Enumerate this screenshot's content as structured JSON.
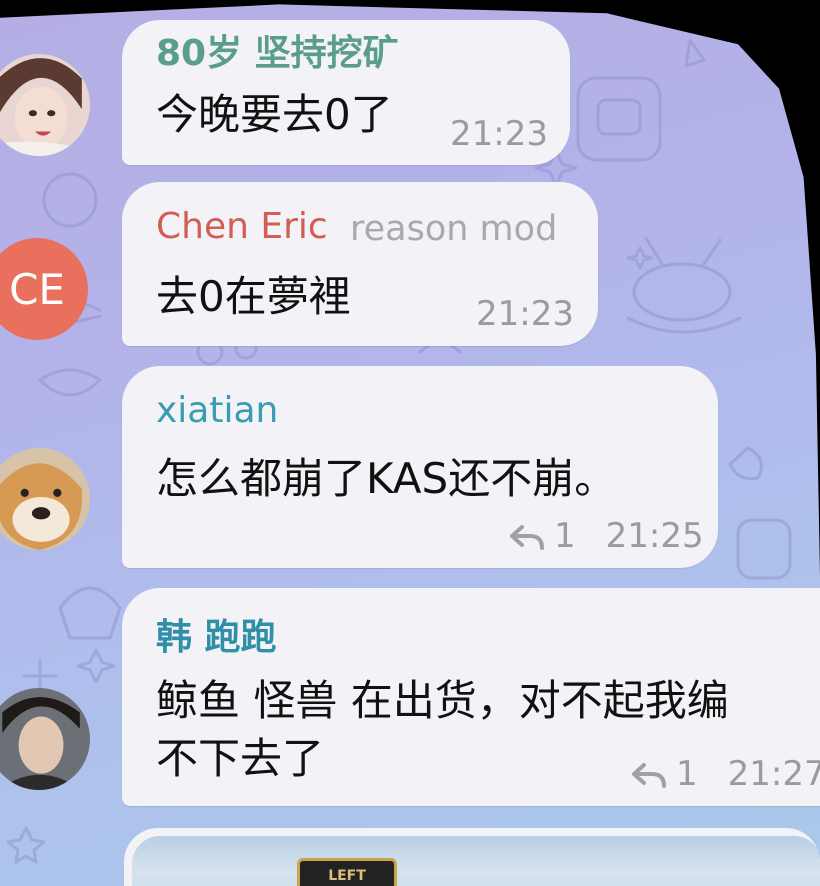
{
  "chat": {
    "messages": [
      {
        "sender": "80岁 坚持挖矿",
        "sender_color": "#5a9e8a",
        "role": "",
        "text": "今晚要去0了",
        "replies": "",
        "time": "21:23"
      },
      {
        "sender": "Chen Eric",
        "sender_color": "#d35d52",
        "role": "reason mod",
        "avatar_initials": "CE",
        "avatar_color": "#e8705d",
        "text": "去0在夢裡",
        "replies": "",
        "time": "21:23"
      },
      {
        "sender": "xiatian",
        "sender_color": "#3a9bb3",
        "role": "",
        "text": "怎么都崩了KAS还不崩。",
        "replies": "1",
        "time": "21:25"
      },
      {
        "sender": "韩 跑跑",
        "sender_color": "#2f8fa8",
        "role": "",
        "text_lines": [
          "鲸鱼 怪兽 在出货，对不起我编",
          "不下去了"
        ],
        "replies": "1",
        "time": "21:27"
      }
    ],
    "partial_card": {
      "sign_text": "LEFT"
    }
  },
  "icons": [
    "reply-icon"
  ],
  "colors": {
    "bubble": "#f2f2f7",
    "meta_text": "#9a9aa1",
    "wallpaper_top": "#b4aee3",
    "wallpaper_bottom": "#a9c9ea"
  }
}
